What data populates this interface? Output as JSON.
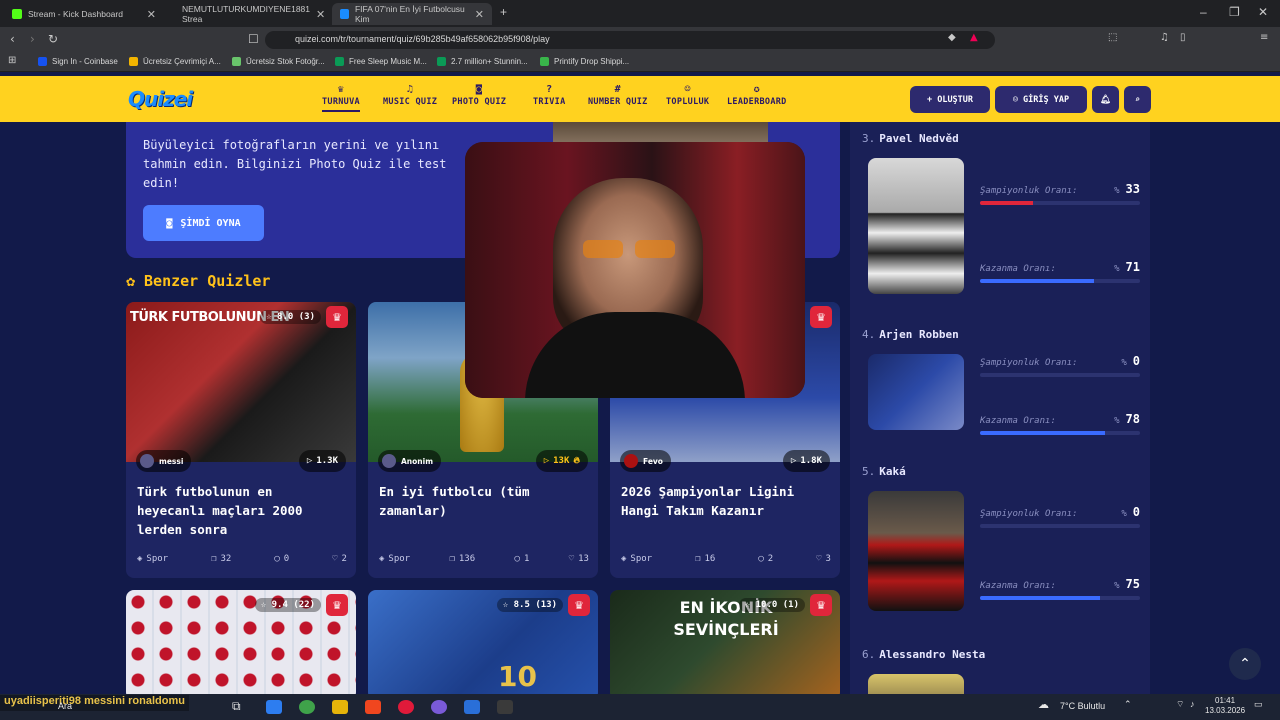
{
  "browser": {
    "tabs": [
      {
        "label": "Stream - Kick Dashboard"
      },
      {
        "label": "NEMUTLUTURKUMDIYENE1881 Strea"
      },
      {
        "label": "FIFA 07'nin En İyi Futbolcusu Kim"
      }
    ],
    "url": "quizei.com/tr/tournament/quiz/69b285b49af658062b95f908/play",
    "bookmarks": [
      {
        "label": "Sign In - Coinbase"
      },
      {
        "label": "Ücretsiz Çevrimiçi A..."
      },
      {
        "label": "Ücretsiz Stok Fotoğr..."
      },
      {
        "label": "Free Sleep Music M..."
      },
      {
        "label": "2.7 million+ Stunnin..."
      },
      {
        "label": "Printify Drop Shippi..."
      }
    ]
  },
  "site": {
    "logo": "Quizei",
    "nav": [
      {
        "label": "TURNUVA",
        "icon": "trophy-icon"
      },
      {
        "label": "MUSIC QUIZ",
        "icon": "music-icon"
      },
      {
        "label": "PHOTO QUIZ",
        "icon": "camera-icon"
      },
      {
        "label": "TRIVIA",
        "icon": "question-icon"
      },
      {
        "label": "NUMBER QUIZ",
        "icon": "hash-icon"
      },
      {
        "label": "TOPLULUK",
        "icon": "users-icon"
      },
      {
        "label": "LEADERBOARD",
        "icon": "medal-icon"
      }
    ],
    "create_label": "+ OLUŞTUR",
    "login_label": "GİRİŞ YAP"
  },
  "hero": {
    "text": "Büyüleyici fotoğrafların yerini ve yılını tahmin edin. Bilginizi Photo Quiz ile test edin!",
    "button": "ŞİMDİ OYNA"
  },
  "similar": {
    "title": "Benzer Quizler",
    "cards": [
      {
        "title": "Türk futbolunun en heyecanlı maçları 2000 lerden sonra",
        "rating": "8.0",
        "rating_count": "(3)",
        "author": "messi",
        "plays": "1.3K",
        "category": "Spor",
        "questions": "32",
        "comments": "0",
        "likes": "2"
      },
      {
        "title": "En iyi futbolcu (tüm zamanlar)",
        "rating": "",
        "rating_count": "",
        "author": "Anonim",
        "plays": "13K",
        "category": "Spor",
        "questions": "136",
        "comments": "1",
        "likes": "13"
      },
      {
        "title": "2026 Şampiyonlar Ligini Hangi Takım Kazanır",
        "rating": "",
        "rating_count": "",
        "author": "Fevo",
        "plays": "1.8K",
        "category": "Spor",
        "questions": "16",
        "comments": "2",
        "likes": "3"
      },
      {
        "title": "",
        "rating": "9.4",
        "rating_count": "(22)"
      },
      {
        "title": "",
        "rating": "8.5",
        "rating_count": "(13)"
      },
      {
        "title": "EN İKONİK SEVİNÇLERİ",
        "rating": "10.0",
        "rating_count": "(1)"
      }
    ]
  },
  "sidebar": {
    "champ_label": "Şampiyonluk Oranı:",
    "win_label": "Kazanma Oranı:",
    "percent_sign": "%",
    "players": [
      {
        "rank": "3.",
        "name": "Pavel Nedvěd",
        "champ": "33",
        "win": "71"
      },
      {
        "rank": "4.",
        "name": "Arjen Robben",
        "champ": "0",
        "win": "78"
      },
      {
        "rank": "5.",
        "name": "Kaká",
        "champ": "0",
        "win": "75"
      },
      {
        "rank": "6.",
        "name": "Alessandro Nesta"
      }
    ]
  },
  "taskbar": {
    "search": "Ara",
    "chat_overlay": "uyadiisperiti98 messini ronaldomu",
    "weather": "7°C Bulutlu",
    "time": "01:41",
    "date": "13.03.2026"
  },
  "colors": {
    "header": "#ffd21f",
    "accent_red": "#e0263b",
    "bar_blue": "#3a6bff",
    "bar_red": "#e0263b"
  }
}
